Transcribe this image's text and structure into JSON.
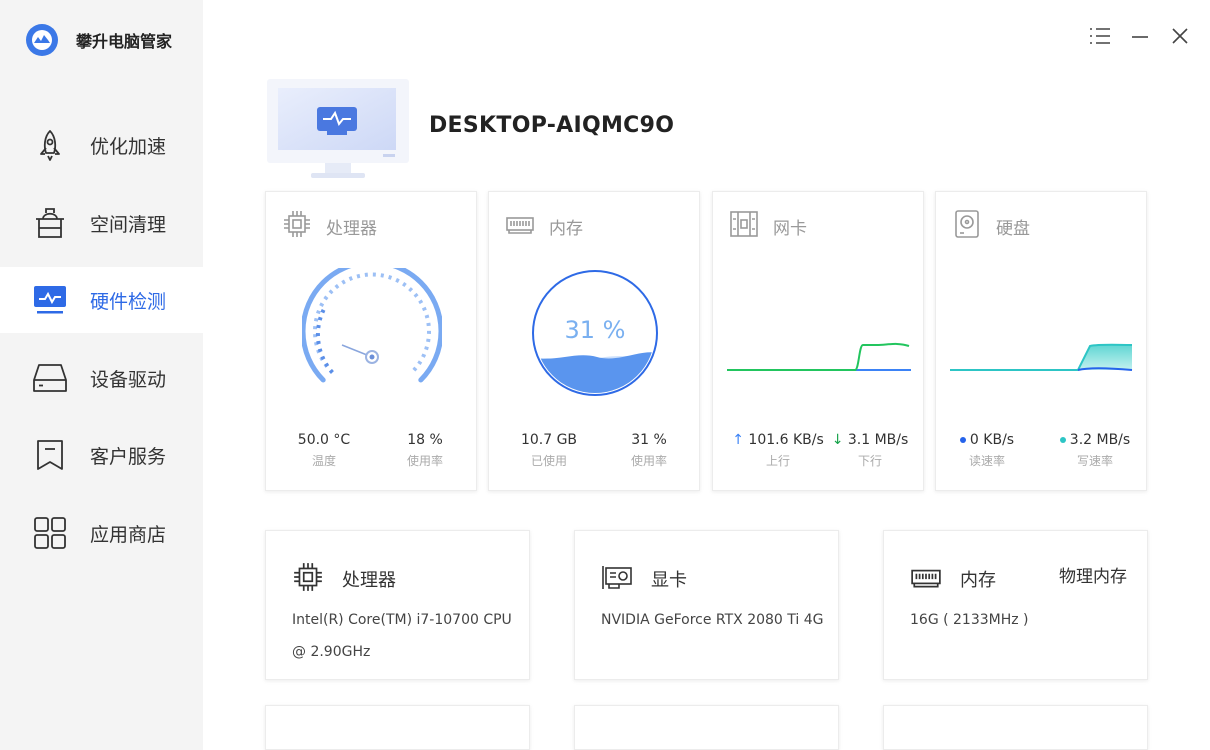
{
  "app": {
    "name": "攀升电脑管家"
  },
  "window_controls": {
    "menu_icon": "menu-icon",
    "minimize_icon": "minimize-icon",
    "close_icon": "close-icon"
  },
  "sidebar": {
    "items": [
      {
        "label": "优化加速",
        "icon": "rocket-icon"
      },
      {
        "label": "空间清理",
        "icon": "trash-icon"
      },
      {
        "label": "硬件检测",
        "icon": "monitor-pulse-icon",
        "active": true
      },
      {
        "label": "设备驱动",
        "icon": "drive-icon"
      },
      {
        "label": "客户服务",
        "icon": "bookmark-icon"
      },
      {
        "label": "应用商店",
        "icon": "grid-icon"
      }
    ]
  },
  "computer": {
    "name": "DESKTOP-AIQMC9O"
  },
  "stats": {
    "cpu": {
      "title": "处理器",
      "temp": "50.0 °C",
      "temp_label": "温度",
      "usage": "18 %",
      "usage_label": "使用率",
      "gauge_fraction": 0.18
    },
    "memory": {
      "title": "内存",
      "percent_text": "31 %",
      "used": "10.7 GB",
      "used_label": "已使用",
      "usage": "31 %",
      "usage_label": "使用率",
      "fill_fraction": 0.31
    },
    "network": {
      "title": "网卡",
      "up": "101.6 KB/s",
      "up_label": "上行",
      "down": "3.1 MB/s",
      "down_label": "下行",
      "up_arrow": "↑",
      "down_arrow": "↓"
    },
    "disk": {
      "title": "硬盘",
      "read": "0 KB/s",
      "read_label": "读速率",
      "write": "3.2 MB/s",
      "write_label": "写速率"
    }
  },
  "colors": {
    "accent": "#2e6ae6",
    "net_down": "#22c55e",
    "net_up": "#3b82f6",
    "disk_write": "#2dc5c5",
    "disk_read": "#2563eb"
  },
  "hardware": [
    {
      "title": "处理器",
      "icon": "cpu-icon",
      "detail": "Intel(R) Core(TM) i7-10700 CPU @ 2.90GHz",
      "extra": ""
    },
    {
      "title": "显卡",
      "icon": "gpu-icon",
      "detail": "NVIDIA GeForce RTX 2080 Ti 4G",
      "extra": ""
    },
    {
      "title": "内存",
      "icon": "ram-icon",
      "detail": "16G ( 2133MHz )",
      "extra": "物理内存"
    }
  ]
}
